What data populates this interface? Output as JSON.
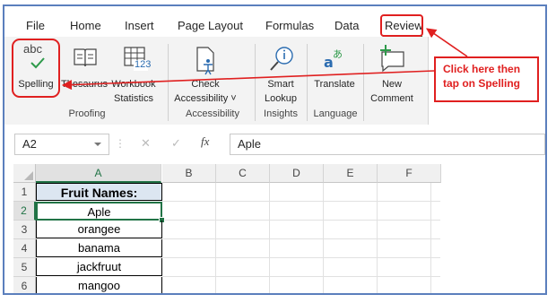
{
  "menu": {
    "tabs": [
      "File",
      "Home",
      "Insert",
      "Page Layout",
      "Formulas",
      "Data",
      "Review"
    ]
  },
  "ribbon": {
    "spelling": "Spelling",
    "spelling_icon_text": "abc",
    "thesaurus": "Thesaurus",
    "workbook": "Workbook",
    "statistics": "Statistics",
    "workbook_icon_number": "123",
    "check": "Check",
    "accessibility": "Accessibility ˅",
    "smart": "Smart",
    "lookup": "Lookup",
    "translate": "Translate",
    "new": "New",
    "comment": "Comment",
    "groups": {
      "proofing": "Proofing",
      "accessibility": "Accessibility",
      "insights": "Insights",
      "language": "Language"
    }
  },
  "formula_bar": {
    "name_box": "A2",
    "value": "Aple",
    "fx": "fx",
    "cancel": "✕",
    "enter": "✓"
  },
  "grid": {
    "columns": [
      "A",
      "B",
      "C",
      "D",
      "E",
      "F"
    ],
    "rows": [
      "1",
      "2",
      "3",
      "4",
      "5",
      "6"
    ],
    "cells": [
      "Fruit Names:",
      "Aple",
      "orangee",
      "banama",
      "jackfruut",
      "mangoo"
    ]
  },
  "annotation": {
    "text": "Click here then tap on Spelling"
  },
  "colors": {
    "annotation_red": "#e02020",
    "frame_blue": "#5b7fbd",
    "excel_green": "#217346",
    "header_fill": "#dce6f1"
  }
}
